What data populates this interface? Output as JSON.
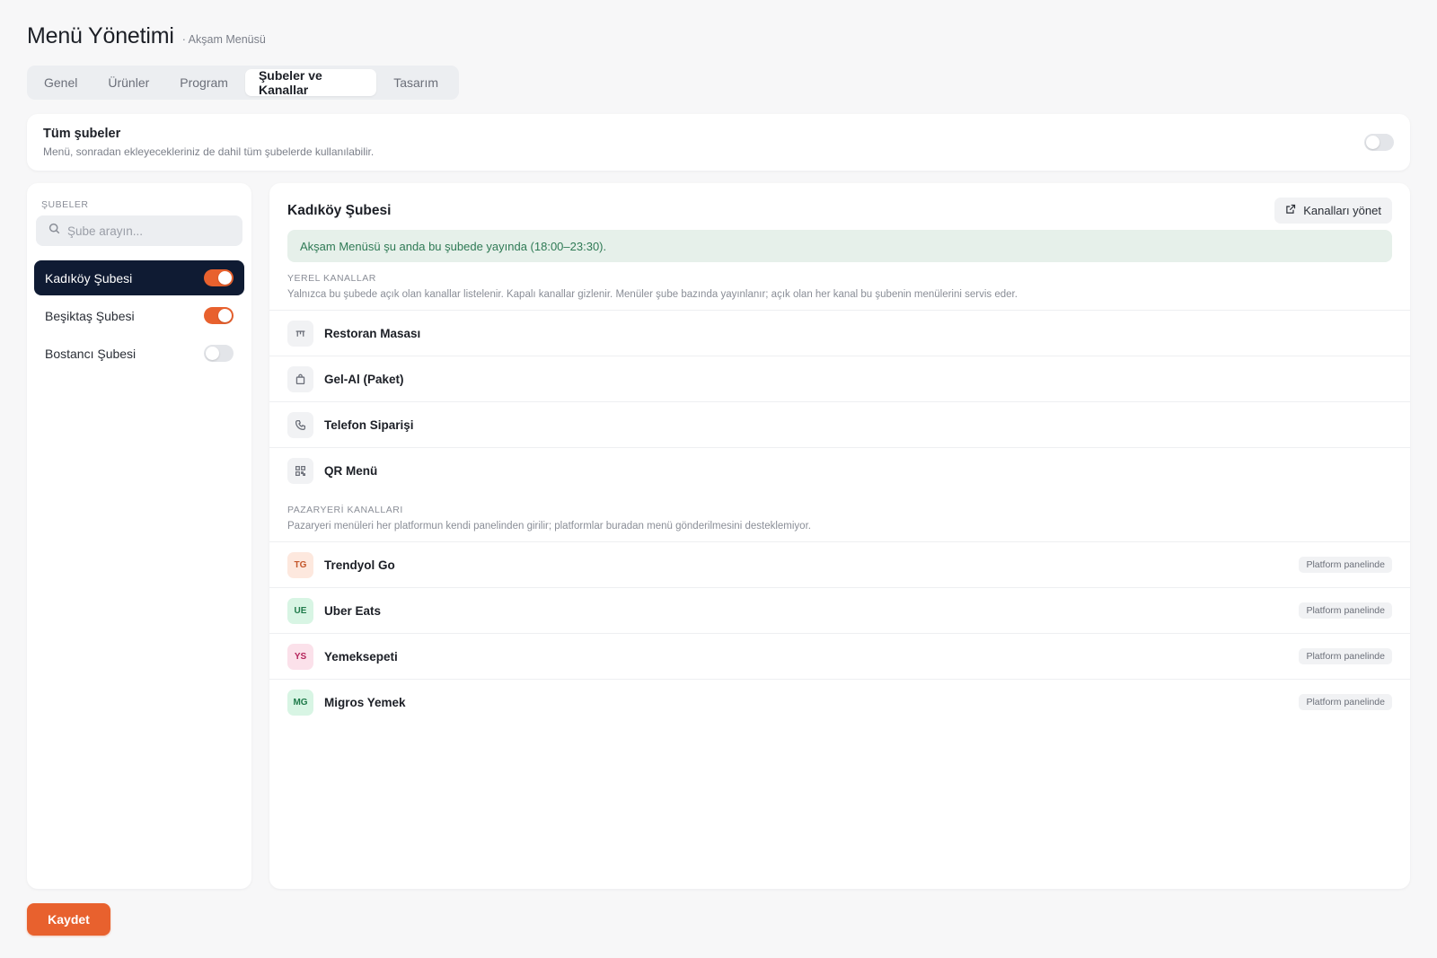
{
  "header": {
    "title": "Menü Yönetimi",
    "subtitle": "· Akşam Menüsü"
  },
  "tabs": [
    {
      "label": "Genel",
      "active": false
    },
    {
      "label": "Ürünler",
      "active": false
    },
    {
      "label": "Program",
      "active": false
    },
    {
      "label": "Şubeler ve Kanallar",
      "active": true
    },
    {
      "label": "Tasarım",
      "active": false
    }
  ],
  "all_branches": {
    "title": "Tüm şubeler",
    "description": "Menü, sonradan ekleyecekleriniz de dahil tüm şubelerde kullanılabilir.",
    "enabled": false
  },
  "sidebar": {
    "label": "ŞUBELER",
    "search_placeholder": "Şube arayın...",
    "branches": [
      {
        "name": "Kadıköy Şubesi",
        "active": true,
        "enabled": true
      },
      {
        "name": "Beşiktaş Şubesi",
        "active": false,
        "enabled": true
      },
      {
        "name": "Bostancı Şubesi",
        "active": false,
        "enabled": false
      }
    ]
  },
  "main": {
    "title": "Kadıköy Şubesi",
    "manage_label": "Kanalları yönet",
    "notice": "Akşam Menüsü şu anda bu şubede yayında (18:00–23:30).",
    "local": {
      "heading": "YEREL KANALLAR",
      "description": "Yalnızca bu şubede açık olan kanallar listelenir. Kapalı kanallar gizlenir. Menüler şube bazında yayınlanır; açık olan her kanal bu şubenin menülerini servis eder.",
      "channels": [
        {
          "label": "Restoran Masası",
          "icon": "table-icon"
        },
        {
          "label": "Gel-Al (Paket)",
          "icon": "bag-icon"
        },
        {
          "label": "Telefon Siparişi",
          "icon": "phone-icon"
        },
        {
          "label": "QR Menü",
          "icon": "qr-icon"
        }
      ]
    },
    "marketplace": {
      "heading": "PAZARYERİ KANALLARI",
      "description": "Pazaryeri menüleri her platformun kendi panelinden girilir; platformlar buradan menü gönderilmesini desteklemiyor.",
      "channels": [
        {
          "abbr": "TG",
          "label": "Trendyol Go",
          "status": "Platform panelinde",
          "bg": "#fde8de",
          "fg": "#c4562a"
        },
        {
          "abbr": "UE",
          "label": "Uber Eats",
          "status": "Platform panelinde",
          "bg": "#d8f5e4",
          "fg": "#1f7a4a"
        },
        {
          "abbr": "YS",
          "label": "Yemeksepeti",
          "status": "Platform panelinde",
          "bg": "#fbe1ea",
          "fg": "#b4235a"
        },
        {
          "abbr": "MG",
          "label": "Migros Yemek",
          "status": "Platform panelinde",
          "bg": "#d8f5e4",
          "fg": "#1f7a4a"
        }
      ]
    }
  },
  "save_label": "Kaydet",
  "colors": {
    "accent": "#e8612e",
    "active_branch": "#0f1b33",
    "notice_bg": "#e6f0ea",
    "notice_text": "#2f7a55"
  }
}
